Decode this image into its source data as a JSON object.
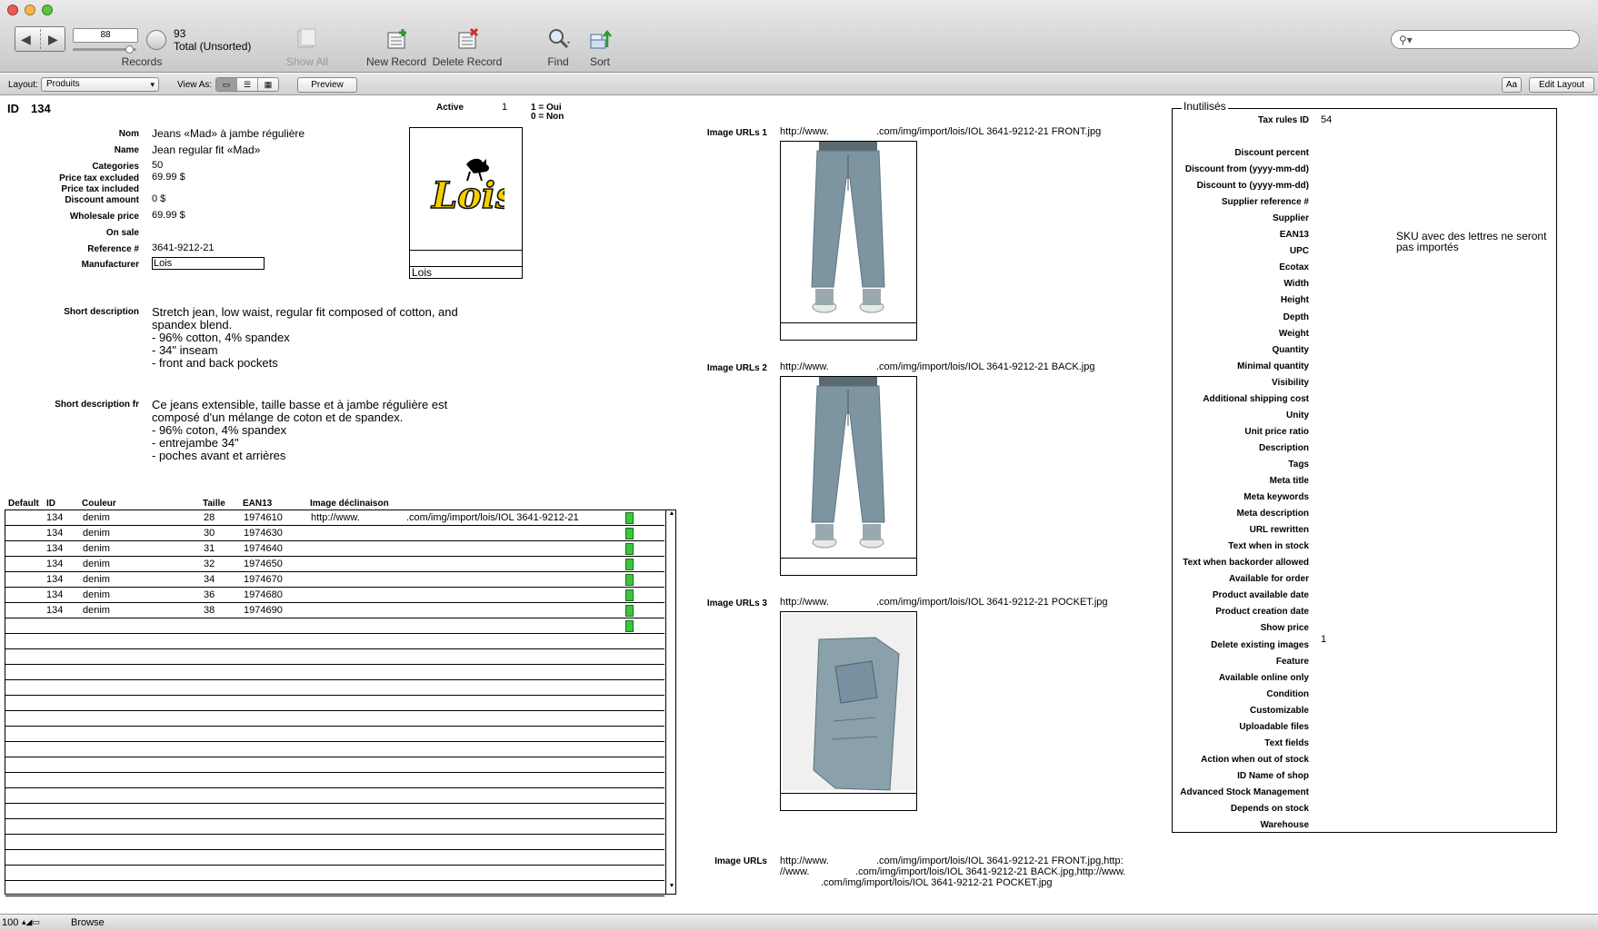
{
  "toolbar": {
    "record_current": "88",
    "record_total": "93",
    "record_sort": "Total (Unsorted)",
    "records_label": "Records",
    "show_all": "Show All",
    "new_record": "New Record",
    "delete_record": "Delete Record",
    "find": "Find",
    "sort": "Sort",
    "search_placeholder": ""
  },
  "layoutbar": {
    "layout_label": "Layout:",
    "layout_value": "Produits",
    "view_as_label": "View As:",
    "preview": "Preview",
    "aa": "Aa",
    "edit_layout": "Edit Layout"
  },
  "record": {
    "id_label": "ID",
    "id_value": "134",
    "active_label": "Active",
    "active_value": "1",
    "active_legend_1": "1 = Oui",
    "active_legend_0": "0 = Non",
    "fields": [
      {
        "label": "Nom",
        "value": "Jeans «Mad» à jambe régulière"
      },
      {
        "label": "Name",
        "value": "Jean regular fit «Mad»"
      },
      {
        "label": "Categories",
        "value": "50"
      },
      {
        "label": "Price tax excluded",
        "value": "69.99 $"
      },
      {
        "label": "Price tax included",
        "value": ""
      },
      {
        "label": "Discount amount",
        "value": "0 $"
      },
      {
        "label": "Wholesale price",
        "value": "69.99 $"
      },
      {
        "label": "On sale",
        "value": ""
      },
      {
        "label": "Reference #",
        "value": "3641-9212-21"
      },
      {
        "label": "Manufacturer",
        "value": "Lois"
      }
    ],
    "logo_caption": "Lois",
    "logo_text": "Lois",
    "short_desc_label": "Short description",
    "short_desc": "Stretch jean, low waist, regular fit composed of cotton, and\nspandex blend.\n- 96% cotton, 4% spandex\n- 34\" inseam\n- front and back pockets",
    "short_desc_fr_label": "Short description fr",
    "short_desc_fr": "Ce jeans extensible, taille basse et à jambe régulière est\ncomposé d'un mélange de coton et de spandex.\n- 96% coton, 4% spandex\n- entrejambe 34\"\n- poches avant et arrières"
  },
  "portal": {
    "headers": [
      "Default",
      "ID",
      "Couleur",
      "Taille",
      "EAN13",
      "Image déclinaison"
    ],
    "rows": [
      {
        "id": "134",
        "couleur": "denim",
        "taille": "28",
        "ean": "1974610",
        "img_a": "http://www.",
        "img_b": ".com/img/import/lois/IOL 3641-9212-21"
      },
      {
        "id": "134",
        "couleur": "denim",
        "taille": "30",
        "ean": "1974630",
        "img_a": "",
        "img_b": ""
      },
      {
        "id": "134",
        "couleur": "denim",
        "taille": "31",
        "ean": "1974640",
        "img_a": "",
        "img_b": ""
      },
      {
        "id": "134",
        "couleur": "denim",
        "taille": "32",
        "ean": "1974650",
        "img_a": "",
        "img_b": ""
      },
      {
        "id": "134",
        "couleur": "denim",
        "taille": "34",
        "ean": "1974670",
        "img_a": "",
        "img_b": ""
      },
      {
        "id": "134",
        "couleur": "denim",
        "taille": "36",
        "ean": "1974680",
        "img_a": "",
        "img_b": ""
      },
      {
        "id": "134",
        "couleur": "denim",
        "taille": "38",
        "ean": "1974690",
        "img_a": "",
        "img_b": ""
      }
    ]
  },
  "images": [
    {
      "label": "Image URLs 1",
      "url_a": "http://www.",
      "url_b": ".com/img/import/lois/IOL 3641-9212-21 FRONT.jpg"
    },
    {
      "label": "Image URLs 2",
      "url_a": "http://www.",
      "url_b": ".com/img/import/lois/IOL 3641-9212-21 BACK.jpg"
    },
    {
      "label": "Image URLs 3",
      "url_a": "http://www.",
      "url_b": ".com/img/import/lois/IOL 3641-9212-21 POCKET.jpg"
    }
  ],
  "image_urls": {
    "label": "Image URLs",
    "line1_a": "http://www.",
    "line1_b": ".com/img/import/lois/IOL 3641-9212-21 FRONT.jpg,http:",
    "line2_a": "//www.",
    "line2_b": ".com/img/import/lois/IOL 3641-9212-21 BACK.jpg,http://www.",
    "line3": ".com/img/import/lois/IOL 3641-9212-21 POCKET.jpg"
  },
  "inutilises": {
    "title": "Inutilisés",
    "tax_label": "Tax rules ID",
    "tax_value": "54",
    "sku_note": "SKU avec des lettres ne seront pas importés",
    "delete_images_value": "1",
    "fields": [
      "Discount percent",
      "Discount from (yyyy-mm-dd)",
      "Discount to (yyyy-mm-dd)",
      "Supplier reference #",
      "Supplier",
      "EAN13",
      "UPC",
      "Ecotax",
      "Width",
      "Height",
      "Depth",
      "Weight",
      "Quantity",
      "Minimal quantity",
      "Visibility",
      "Additional shipping cost",
      "Unity",
      "Unit price ratio",
      "Description",
      "Tags",
      "Meta title",
      "Meta keywords",
      "Meta description",
      "URL rewritten",
      "Text when in stock",
      "Text when backorder allowed",
      "Available for order",
      "Product available date",
      "Product creation date",
      "Show price",
      "Delete existing images",
      "Feature",
      "Available online only",
      "Condition",
      "Customizable",
      "Uploadable files",
      "Text fields",
      "Action when out of stock",
      "ID Name of shop",
      "Advanced Stock Management",
      "Depends on stock",
      "Warehouse"
    ]
  },
  "statusbar": {
    "zoom": "100",
    "mode": "Browse"
  },
  "colors": {
    "accent_green": "#38c938",
    "logo_yellow": "#f5d000"
  }
}
